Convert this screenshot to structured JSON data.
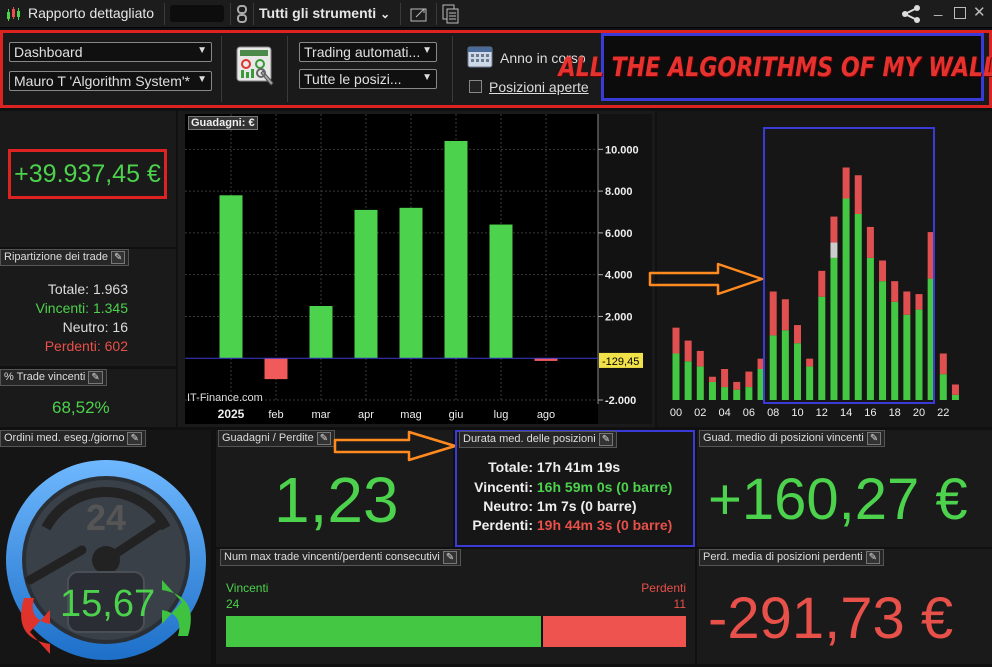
{
  "titlebar": {
    "title": "Rapporto dettagliato",
    "account_masked": "",
    "instruments_label": "Tutti gli strumenti",
    "chevron": "⌄"
  },
  "toolbar": {
    "view_select": "Dashboard",
    "system_select": "Mauro T 'Algorithm System'*",
    "trading_select": "Trading automati...",
    "positions_select": "Tutte le posizi...",
    "period_label": "Anno in corso",
    "open_positions_label": "Posizioni aperte",
    "banner_text": "ALL THE ALGORITHMS OF MY WALLET"
  },
  "summary": {
    "profit": "+39.937,45 €"
  },
  "trades_breakdown": {
    "header": "Ripartizione dei trade",
    "total_label": "Totale:",
    "total_value": "1.963",
    "win_label": "Vincenti:",
    "win_value": "1.345",
    "neutral_label": "Neutro:",
    "neutral_value": "16",
    "loss_label": "Perdenti:",
    "loss_value": "602"
  },
  "win_rate": {
    "header": "% Trade vincenti",
    "value": "68,52%"
  },
  "monthly_chart": {
    "header": "Guadagni: €",
    "watermark": "IT-Finance.com",
    "last_value_label": "-129,45",
    "colors": {
      "positive": "#4cd24c",
      "negative": "#f05a5a",
      "zero_line": "#3b3bd0"
    }
  },
  "hourly_chart": {
    "colors": {
      "win": "#44c844",
      "loss": "#e05050",
      "neutral": "#cccccc",
      "highlight_box": "#3a3ad8"
    }
  },
  "avg_orders": {
    "header": "Ordini med. eseg./giorno",
    "clock_label": "24",
    "value": "15,67"
  },
  "profit_loss_ratio": {
    "header": "Guadagni / Perdite",
    "value": "1,23"
  },
  "avg_duration": {
    "header": "Durata med. delle posizioni",
    "total_label": "Totale:",
    "total_value": "17h 41m 19s",
    "win_label": "Vincenti:",
    "win_value": "16h 59m 0s (0 barre)",
    "neutral_label": "Neutro:",
    "neutral_value": "1m 7s (0 barre)",
    "loss_label": "Perdenti:",
    "loss_value": "19h 44m 3s (0 barre)"
  },
  "avg_win": {
    "header": "Guad. medio di posizioni vincenti",
    "value": "+160,27 €"
  },
  "consecutive": {
    "header": "Num max trade vincenti/perdenti consecutivi",
    "win_label": "Vincenti",
    "win_value": "24",
    "loss_label": "Perdenti",
    "loss_value": "11",
    "win_count": 24,
    "loss_count": 11
  },
  "avg_loss": {
    "header": "Perd. media di posizioni perdenti",
    "value": "-291,73 €"
  },
  "chart_data": [
    {
      "type": "bar",
      "categories": [
        "2025",
        "feb",
        "mar",
        "apr",
        "mag",
        "giu",
        "lug",
        "ago"
      ],
      "values": [
        7800,
        -1000,
        2500,
        7100,
        7200,
        10400,
        6400,
        -129.45
      ],
      "title": "Guadagni: €",
      "xlabel": "",
      "ylabel": "",
      "ylim": [
        -2000,
        11500
      ],
      "yticks": [
        -2000,
        2000,
        4000,
        6000,
        8000,
        10000
      ],
      "ytick_labels": [
        "-2.000",
        "2.000",
        "4.000",
        "6.000",
        "8.000",
        "10.000"
      ],
      "grid": true
    },
    {
      "type": "bar",
      "stacked": true,
      "categories": [
        "00",
        "01",
        "02",
        "03",
        "04",
        "05",
        "06",
        "07",
        "08",
        "09",
        "10",
        "11",
        "12",
        "13",
        "14",
        "15",
        "16",
        "17",
        "18",
        "19",
        "20",
        "21",
        "22",
        "23"
      ],
      "xtick_labels": [
        "00",
        "02",
        "04",
        "06",
        "08",
        "10",
        "12",
        "14",
        "16",
        "18",
        "20",
        "22"
      ],
      "series": [
        {
          "values": [
            18,
            15,
            13,
            7,
            5,
            4,
            5,
            12,
            25,
            27,
            22,
            13,
            40,
            55,
            78,
            72,
            55,
            46,
            38,
            33,
            35,
            47,
            10,
            2
          ]
        },
        {
          "values": [
            10,
            8,
            6,
            2,
            7,
            3,
            6,
            4,
            17,
            12,
            7,
            3,
            10,
            10,
            12,
            15,
            12,
            8,
            8,
            9,
            6,
            18,
            8,
            4
          ]
        },
        {
          "values": [
            0,
            0,
            0,
            0,
            0,
            0,
            0,
            0,
            0,
            0,
            0,
            0,
            0,
            6,
            0,
            0,
            0,
            0,
            0,
            0,
            0,
            0,
            0,
            0
          ]
        }
      ],
      "ylim": [
        0,
        108
      ]
    }
  ]
}
